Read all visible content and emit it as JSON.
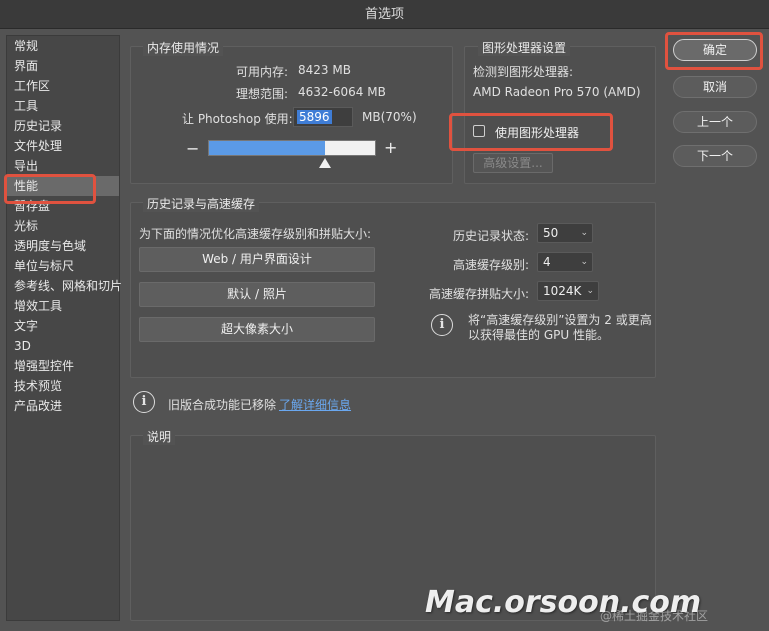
{
  "window": {
    "title": "首选项"
  },
  "sidebar": {
    "items": [
      {
        "label": "常规"
      },
      {
        "label": "界面"
      },
      {
        "label": "工作区"
      },
      {
        "label": "工具"
      },
      {
        "label": "历史记录"
      },
      {
        "label": "文件处理"
      },
      {
        "label": "导出"
      },
      {
        "label": "性能"
      },
      {
        "label": "暂存盘"
      },
      {
        "label": "光标"
      },
      {
        "label": "透明度与色域"
      },
      {
        "label": "单位与标尺"
      },
      {
        "label": "参考线、网格和切片"
      },
      {
        "label": "增效工具"
      },
      {
        "label": "文字"
      },
      {
        "label": "3D"
      },
      {
        "label": "增强型控件"
      },
      {
        "label": "技术预览"
      },
      {
        "label": "产品改进"
      }
    ],
    "active_index": 7
  },
  "memory": {
    "title": "内存使用情况",
    "available_label": "可用内存:",
    "available_value": "8423 MB",
    "ideal_label": "理想范围:",
    "ideal_value": "4632-6064 MB",
    "let_label": "让 Photoshop 使用:",
    "let_value": "5896",
    "let_suffix": "MB(70%)",
    "minus": "−",
    "plus": "+",
    "slider_percent": 70
  },
  "gpu": {
    "title": "图形处理器设置",
    "detected_label": "检测到图形处理器:",
    "gpu_name": "AMD Radeon Pro 570 (AMD)",
    "use_gpu_label": "使用图形处理器",
    "advanced_label": "高级设置..."
  },
  "cache": {
    "title": "历史记录与高速缓存",
    "optimize_label": "为下面的情况优化高速缓存级别和拼贴大小:",
    "btn_web": "Web / 用户界面设计",
    "btn_default": "默认 / 照片",
    "btn_huge": "超大像素大小",
    "history_label": "历史记录状态:",
    "history_value": "50",
    "levels_label": "高速缓存级别:",
    "levels_value": "4",
    "tile_label": "高速缓存拼贴大小:",
    "tile_value": "1024K",
    "info_line1": "将“高速缓存级别”设置为 2 或更高",
    "info_line2": "以获得最佳的 GPU 性能。"
  },
  "legacy": {
    "text": "旧版合成功能已移除",
    "link": "了解详细信息"
  },
  "description": {
    "title": "说明"
  },
  "buttons": {
    "ok": "确定",
    "cancel": "取消",
    "prev": "上一个",
    "next": "下一个"
  },
  "icons": {
    "info": "info-icon",
    "chevron": "chevron-down-icon",
    "checkbox": "checkbox-icon"
  },
  "watermark": {
    "main": "Mac.orsoon.com",
    "sub": "@稀土掘金技术社区"
  },
  "colors": {
    "accent": "#4a90e2",
    "callout": "#e0523f"
  }
}
